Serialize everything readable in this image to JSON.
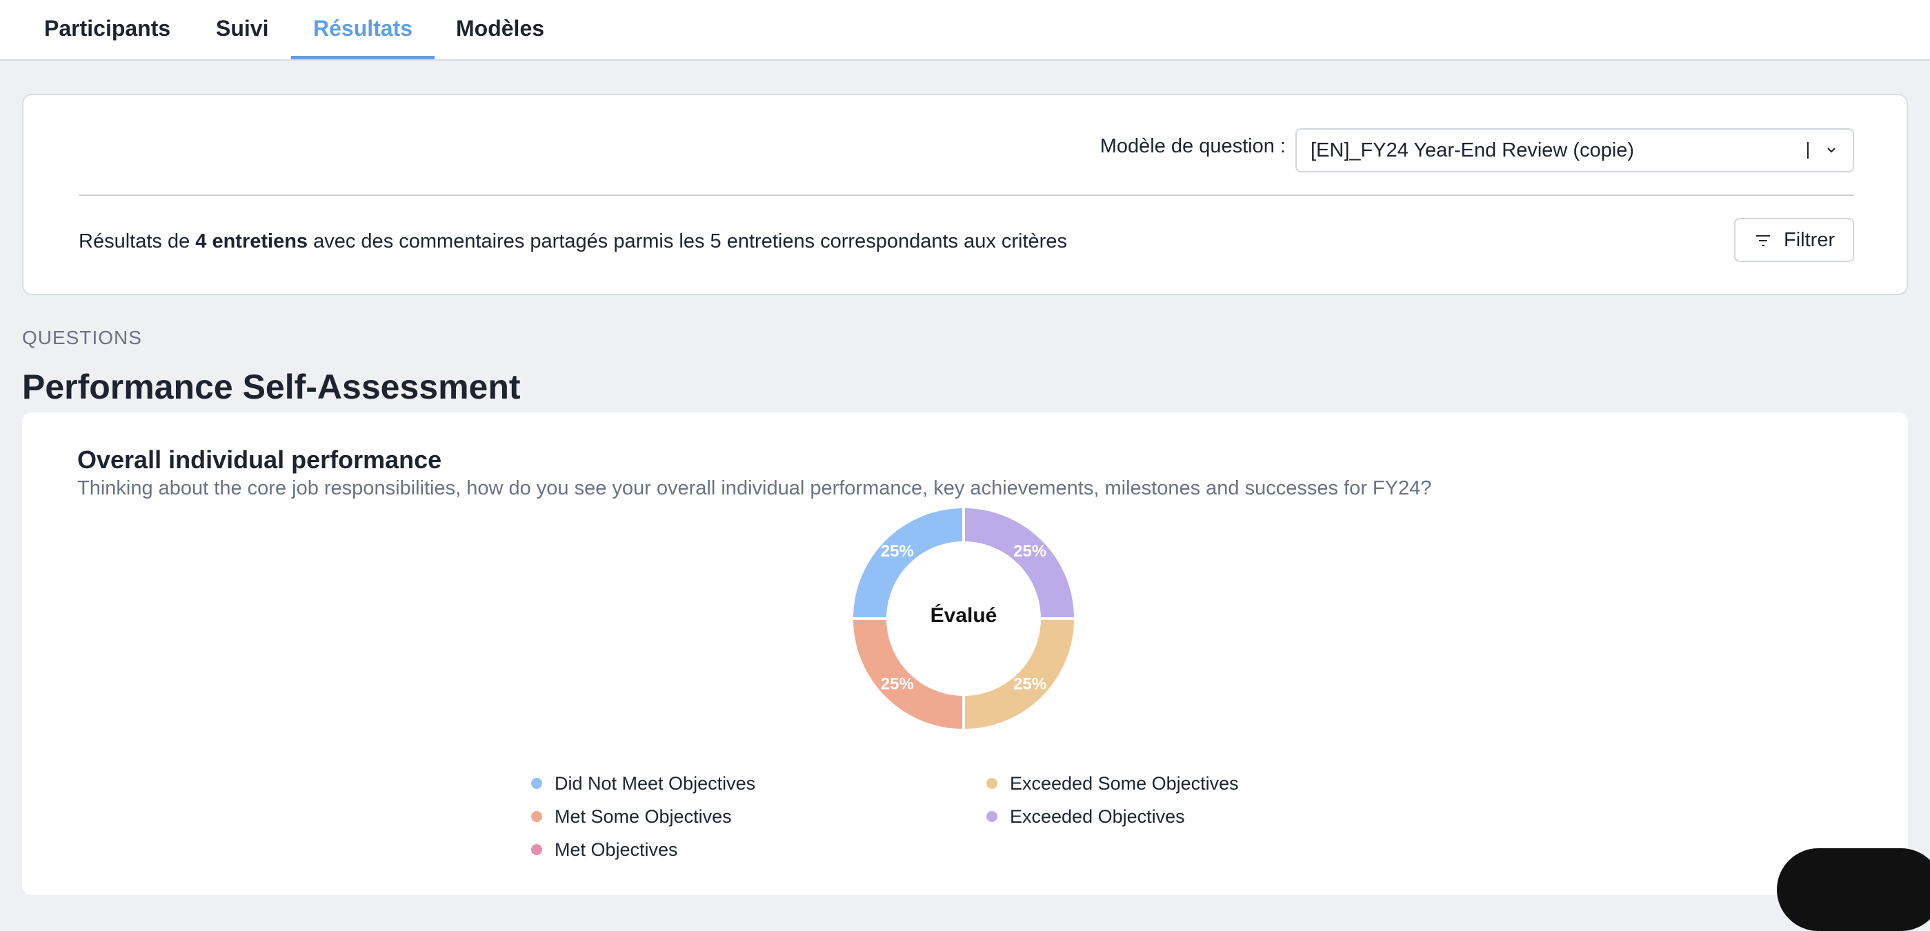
{
  "tabs": [
    {
      "label": "Participants",
      "active": false
    },
    {
      "label": "Suivi",
      "active": false
    },
    {
      "label": "Résultats",
      "active": true
    },
    {
      "label": "Modèles",
      "active": false
    }
  ],
  "filter_card": {
    "template_label": "Modèle de question :",
    "template_value": "[EN]_FY24 Year-End Review (copie)",
    "results_prefix": "Résultats de ",
    "results_bold": "4 entretiens",
    "results_suffix": " avec des commentaires partagés parmis les 5 entretiens correspondants aux critères",
    "filter_button": "Filtrer"
  },
  "section_label": "QUESTIONS",
  "section_title": "Performance Self-Assessment",
  "question": {
    "title": "Overall individual performance",
    "description": "Thinking about the core job responsibilities, how do you see your overall individual performance, key achievements, milestones and successes for FY24?"
  },
  "chart_data": {
    "type": "pie",
    "center_label": "Évalué",
    "categories": [
      "Did Not Meet Objectives",
      "Met Some Objectives",
      "Met Objectives",
      "Exceeded Some Objectives",
      "Exceeded Objectives"
    ],
    "values": [
      25,
      25,
      0,
      25,
      25
    ],
    "value_labels": [
      "25%",
      "25%",
      "",
      "25%",
      "25%"
    ],
    "colors": [
      "#92c0f6",
      "#f0a98f",
      "#e48fa9",
      "#edc895",
      "#bcabe8"
    ],
    "legend_placement": "bottom"
  }
}
